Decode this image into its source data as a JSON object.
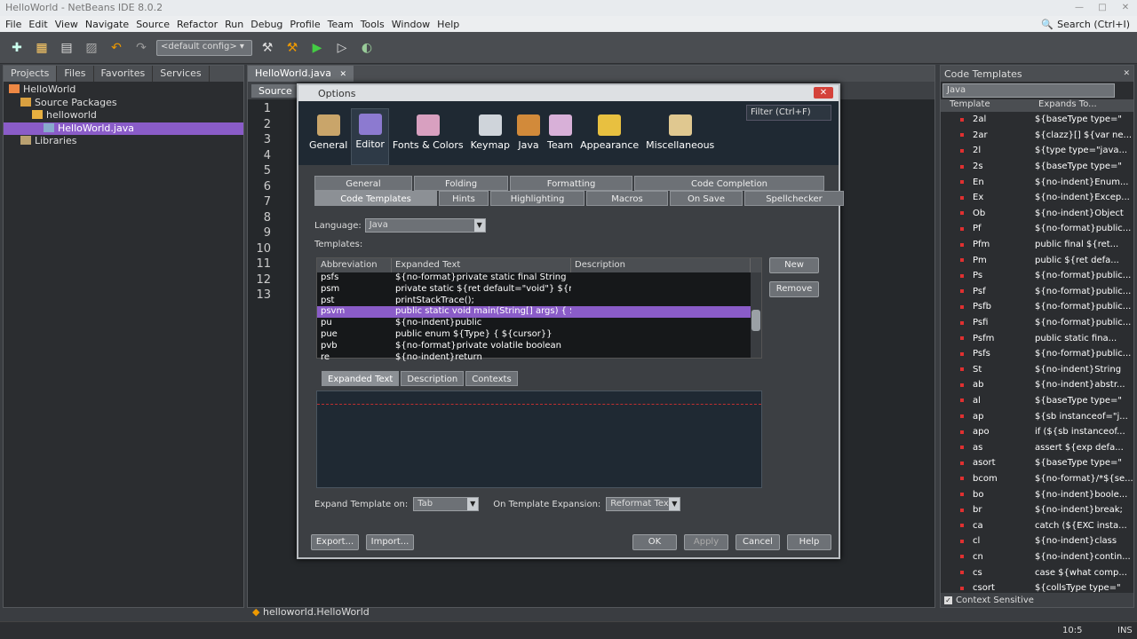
{
  "window": {
    "title": "HelloWorld - NetBeans IDE 8.0.2"
  },
  "menu": [
    "File",
    "Edit",
    "View",
    "Navigate",
    "Source",
    "Refactor",
    "Run",
    "Debug",
    "Profile",
    "Team",
    "Tools",
    "Window",
    "Help"
  ],
  "search": {
    "placeholder": "Search (Ctrl+I)"
  },
  "toolbar": {
    "config": "<default config>"
  },
  "left_panel": {
    "tabs": [
      "Projects",
      "Files",
      "Favorites",
      "Services"
    ],
    "tree": [
      {
        "label": "HelloWorld",
        "indent": 0,
        "selected": false
      },
      {
        "label": "Source Packages",
        "indent": 1,
        "selected": false
      },
      {
        "label": "helloworld",
        "indent": 2,
        "selected": false
      },
      {
        "label": "HelloWorld.java",
        "indent": 3,
        "selected": true
      },
      {
        "label": "Libraries",
        "indent": 1,
        "selected": false
      }
    ]
  },
  "editor": {
    "tab": "HelloWorld.java",
    "source_button": "Source",
    "line_numbers": [
      "1",
      "2",
      "3",
      "4",
      "5",
      "6",
      "7",
      "8",
      "9",
      "10",
      "11",
      "12",
      "13"
    ],
    "breadcrumb": "helloworld.HelloWorld"
  },
  "right_panel": {
    "title": "Code Templates",
    "language": "Java",
    "columns": [
      "Template",
      "Expands To..."
    ],
    "rows": [
      [
        "2al",
        "${baseType type=\""
      ],
      [
        "2ar",
        "${clazz}[] ${var ne..."
      ],
      [
        "2l",
        "${type type=\"java..."
      ],
      [
        "2s",
        "${baseType type=\""
      ],
      [
        "En",
        "${no-indent}Enum..."
      ],
      [
        "Ex",
        "${no-indent}Excep..."
      ],
      [
        "Ob",
        "${no-indent}Object"
      ],
      [
        "Pf",
        "${no-format}public..."
      ],
      [
        "Pfm",
        "public final ${ret..."
      ],
      [
        "Pm",
        "public ${ret defa..."
      ],
      [
        "Ps",
        "${no-format}public..."
      ],
      [
        "Psf",
        "${no-format}public..."
      ],
      [
        "Psfb",
        "${no-format}public..."
      ],
      [
        "Psfi",
        "${no-format}public..."
      ],
      [
        "Psfm",
        "public static fina..."
      ],
      [
        "Psfs",
        "${no-format}public..."
      ],
      [
        "St",
        "${no-indent}String"
      ],
      [
        "ab",
        "${no-indent}abstr..."
      ],
      [
        "al",
        "${baseType type=\""
      ],
      [
        "ap",
        "${sb instanceof=\"j..."
      ],
      [
        "apo",
        "if (${sb instanceof..."
      ],
      [
        "as",
        "assert ${exp defa..."
      ],
      [
        "asort",
        "${baseType type=\""
      ],
      [
        "bcom",
        "${no-format}/*${se..."
      ],
      [
        "bo",
        "${no-indent}boole..."
      ],
      [
        "br",
        "${no-indent}break;"
      ],
      [
        "ca",
        "catch (${EXC insta..."
      ],
      [
        "cl",
        "${no-indent}class"
      ],
      [
        "cn",
        "${no-indent}contin..."
      ],
      [
        "cs",
        "case ${what comp..."
      ],
      [
        "csort",
        "${collsType type=\""
      ]
    ],
    "footer": "Context Sensitive"
  },
  "status": {
    "position": "10:5",
    "mode": "INS"
  },
  "dialog": {
    "title": "Options",
    "filter_placeholder": "Filter (Ctrl+F)",
    "categories": [
      {
        "label": "General",
        "color": "#c9a56a"
      },
      {
        "label": "Editor",
        "color": "#8c7ad0"
      },
      {
        "label": "Fonts & Colors",
        "color": "#d8a0c0"
      },
      {
        "label": "Keymap",
        "color": "#cfd4da"
      },
      {
        "label": "Java",
        "color": "#d28a3a"
      },
      {
        "label": "Team",
        "color": "#d8b0d8"
      },
      {
        "label": "Appearance",
        "color": "#e8c040"
      },
      {
        "label": "Miscellaneous",
        "color": "#e0c890"
      }
    ],
    "active_category": "Editor",
    "tabs_row1": [
      "General",
      "Folding",
      "Formatting",
      "Code Completion"
    ],
    "tabs_row2": [
      "Code Templates",
      "Hints",
      "Highlighting",
      "Macros",
      "On Save",
      "Spellchecker"
    ],
    "language_label": "Language:",
    "language_value": "Java",
    "templates_label": "Templates:",
    "columns": [
      "Abbreviation",
      "Expanded Text",
      "Description"
    ],
    "rows": [
      {
        "abbr": "psfs",
        "text": "${no-format}private static final String",
        "desc": ""
      },
      {
        "abbr": "psm",
        "text": "    private static ${ret default=\"void\"} ${mna...",
        "desc": ""
      },
      {
        "abbr": "pst",
        "text": "printStackTrace();",
        "desc": ""
      },
      {
        "abbr": "psvm",
        "text": "public static void main(String[] args) {   ${cu...",
        "desc": ""
      },
      {
        "abbr": "pu",
        "text": "${no-indent}public",
        "desc": ""
      },
      {
        "abbr": "pue",
        "text": "public enum ${Type} {   ${cursor}}",
        "desc": ""
      },
      {
        "abbr": "pvb",
        "text": "${no-format}private volatile boolean",
        "desc": ""
      },
      {
        "abbr": "re",
        "text": "${no-indent}return",
        "desc": ""
      }
    ],
    "new_button": "New",
    "remove_button": "Remove",
    "subtabs": [
      "Expanded Text",
      "Description",
      "Contexts"
    ],
    "expand_on_label": "Expand Template on:",
    "expand_on_value": "Tab",
    "on_expansion_label": "On Template Expansion:",
    "on_expansion_value": "Reformat Text",
    "export_button": "Export...",
    "import_button": "Import...",
    "ok_button": "OK",
    "apply_button": "Apply",
    "cancel_button": "Cancel",
    "help_button": "Help"
  }
}
